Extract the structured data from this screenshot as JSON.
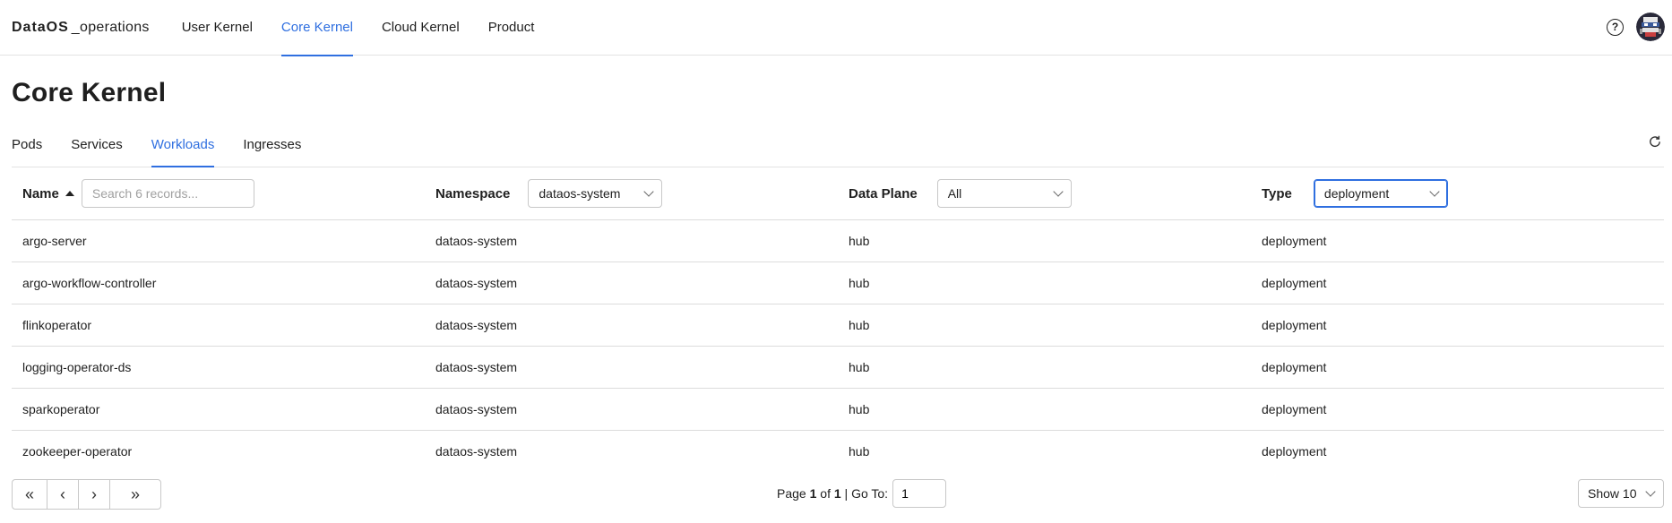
{
  "brand": {
    "logo_main": "DataOS",
    "logo_suffix": "_operations"
  },
  "nav": {
    "items": [
      {
        "label": "User Kernel"
      },
      {
        "label": "Core Kernel",
        "active": true
      },
      {
        "label": "Cloud Kernel"
      },
      {
        "label": "Product"
      }
    ]
  },
  "page": {
    "title": "Core Kernel"
  },
  "subtabs": [
    {
      "label": "Pods"
    },
    {
      "label": "Services"
    },
    {
      "label": "Workloads",
      "active": true
    },
    {
      "label": "Ingresses"
    }
  ],
  "table": {
    "headers": {
      "name": "Name",
      "namespace": "Namespace",
      "data_plane": "Data Plane",
      "type": "Type"
    },
    "filters": {
      "search_placeholder": "Search 6 records...",
      "namespace_value": "dataos-system",
      "data_plane_value": "All",
      "type_value": "deployment"
    },
    "rows": [
      {
        "name": "argo-server",
        "namespace": "dataos-system",
        "data_plane": "hub",
        "type": "deployment"
      },
      {
        "name": "argo-workflow-controller",
        "namespace": "dataos-system",
        "data_plane": "hub",
        "type": "deployment"
      },
      {
        "name": "flinkoperator",
        "namespace": "dataos-system",
        "data_plane": "hub",
        "type": "deployment"
      },
      {
        "name": "logging-operator-ds",
        "namespace": "dataos-system",
        "data_plane": "hub",
        "type": "deployment"
      },
      {
        "name": "sparkoperator",
        "namespace": "dataos-system",
        "data_plane": "hub",
        "type": "deployment"
      },
      {
        "name": "zookeeper-operator",
        "namespace": "dataos-system",
        "data_plane": "hub",
        "type": "deployment"
      }
    ]
  },
  "pagination": {
    "page_prefix": "Page ",
    "current_page": "1",
    "of_text": " of ",
    "total_pages": "1",
    "goto_label": " | Go To:",
    "goto_value": "1",
    "show_label": "Show 10"
  },
  "icons": {
    "help": "?",
    "first": "«",
    "prev": "‹",
    "next": "›",
    "last": "»"
  },
  "colors": {
    "accent": "#2f6fe0",
    "border": "#dcdcdc"
  }
}
